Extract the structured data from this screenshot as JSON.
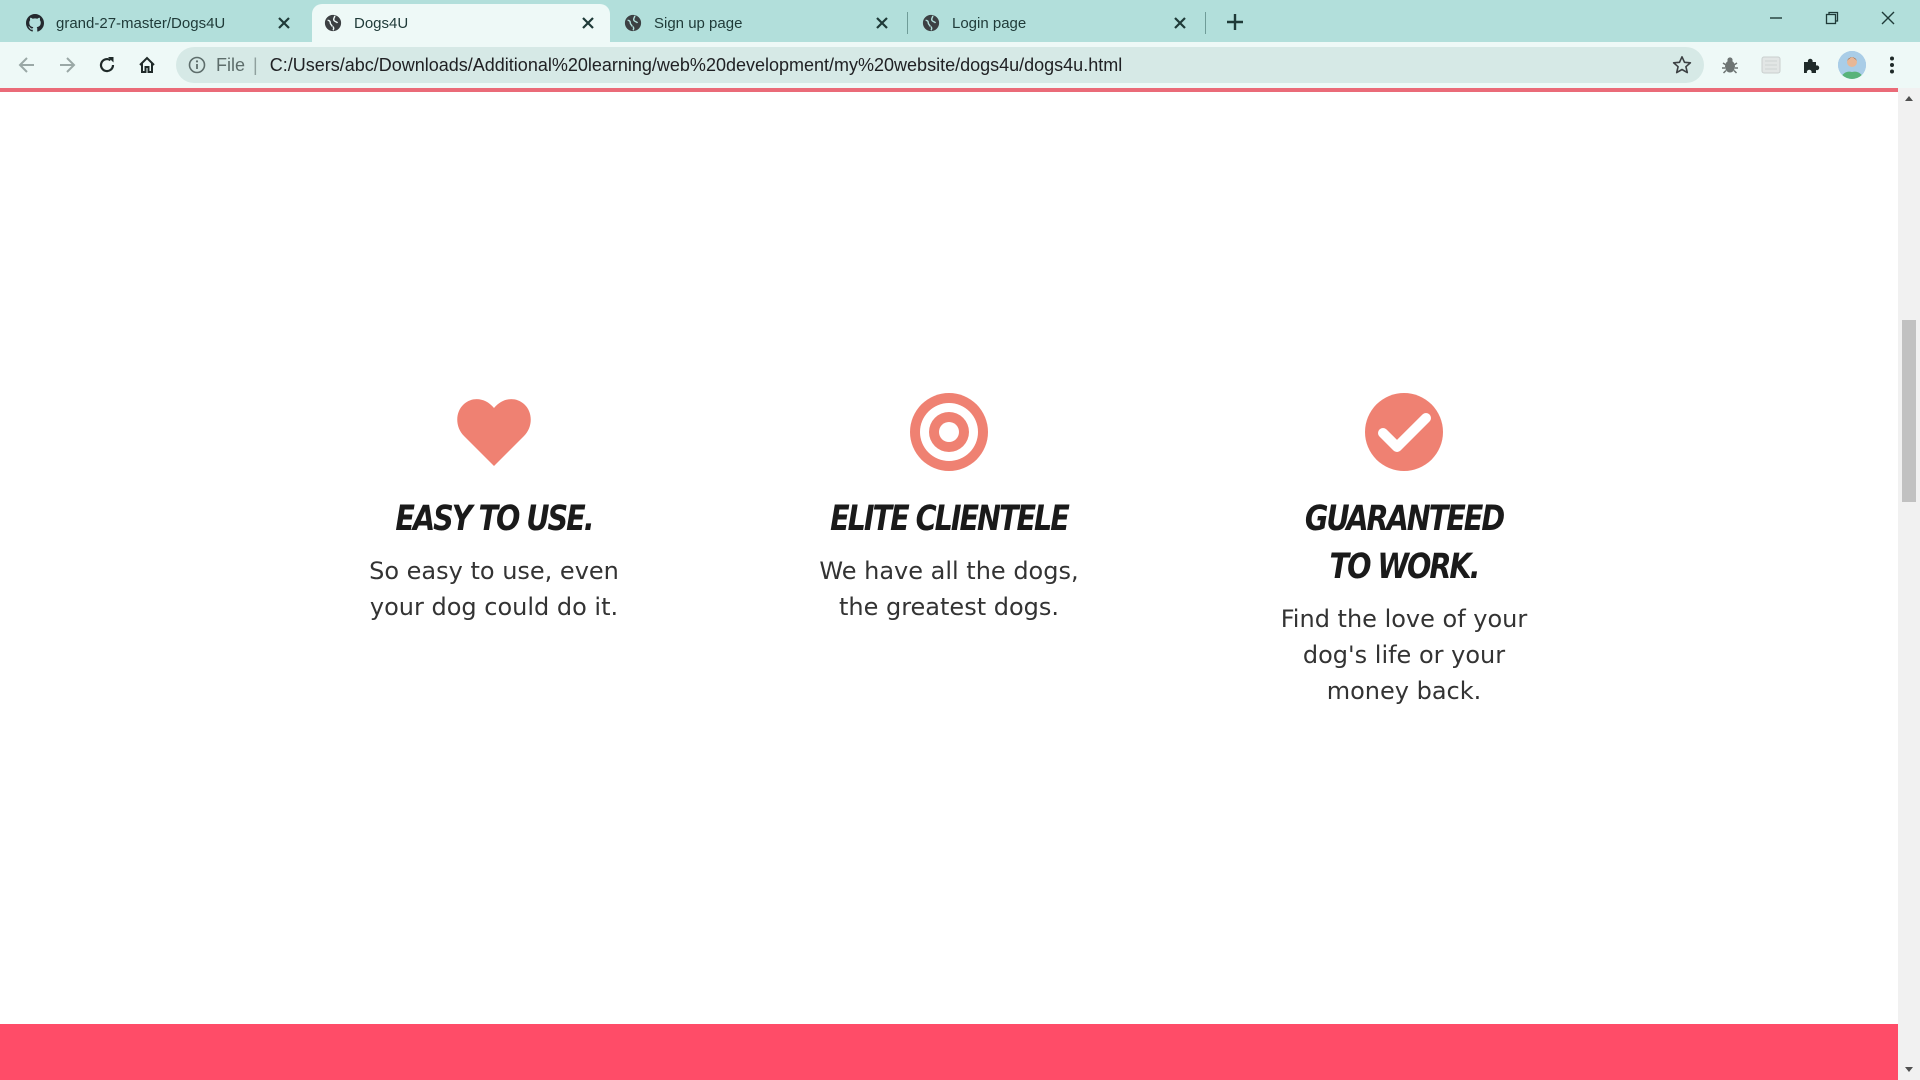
{
  "browser": {
    "tabs": [
      {
        "title": "grand-27-master/Dogs4U",
        "icon": "github-icon",
        "active": false
      },
      {
        "title": "Dogs4U",
        "icon": "globe-icon",
        "active": true
      },
      {
        "title": "Sign up page",
        "icon": "globe-icon",
        "active": false
      },
      {
        "title": "Login page",
        "icon": "globe-icon",
        "active": false
      }
    ],
    "address": {
      "scheme_label": "File",
      "url": "C:/Users/abc/Downloads/Additional%20learning/web%20development/my%20website/dogs4u/dogs4u.html"
    }
  },
  "page": {
    "features": [
      {
        "icon": "heart-icon",
        "title": "Easy to use.",
        "line1": "So easy to use, even",
        "line2": "your dog could do it.",
        "line3": ""
      },
      {
        "icon": "bullseye-icon",
        "title": "Elite Clientele",
        "line1": "We have all the dogs,",
        "line2": "the greatest dogs.",
        "line3": ""
      },
      {
        "icon": "check-circle-icon",
        "title": "Guaranteed to work.",
        "line1": "Find the love of your",
        "line2": "dog's life or your",
        "line3": "money back."
      }
    ]
  },
  "colors": {
    "tab_strip": "#b2dfdb",
    "toolbar": "#eef9f7",
    "accent_icon": "#ef8172",
    "footer_band": "#ff4c68",
    "top_rule": "#ea6b78"
  }
}
